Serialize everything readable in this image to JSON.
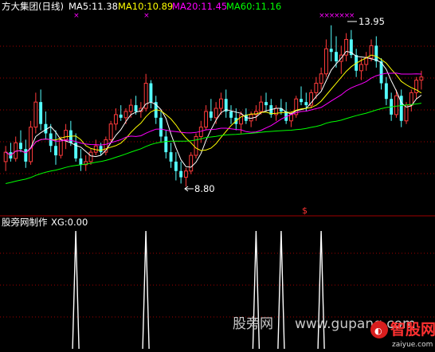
{
  "header": {
    "stock_name": "方大集团(日线)",
    "ma5_label": "MA5:11.38",
    "ma10_label": "MA10:10.89",
    "ma20_label": "MA20:11.45",
    "ma60_label": "MA60:11.16"
  },
  "colors": {
    "up": "#ff3b3b",
    "down": "#54ffff",
    "ma5": "#ffffff",
    "ma10": "#ffff00",
    "ma20": "#ff00ff",
    "ma60": "#00ff00",
    "grid": "#a00000",
    "marker": "#ff00ff",
    "signal": "#ffffff",
    "dollar": "#ff3333"
  },
  "indicator": {
    "title": "股旁网制作",
    "xg_label": "XG:0.00"
  },
  "watermark": {
    "site1": "股旁网",
    "url": "www.gupang.com",
    "brand": "智股网",
    "brand_url": "zaiyue.com"
  },
  "chart_data": [
    {
      "type": "candlestick",
      "title": "方大集团(日线)",
      "annotations": [
        {
          "text": "13.95",
          "kind": "high"
        },
        {
          "text": "8.80",
          "kind": "low"
        }
      ],
      "ohlc": [
        [
          9.6,
          10.1,
          9.3,
          9.9
        ],
        [
          9.9,
          10.2,
          9.6,
          9.7
        ],
        [
          9.7,
          10.4,
          9.6,
          10.2
        ],
        [
          10.2,
          10.6,
          9.9,
          10.0
        ],
        [
          10.0,
          10.3,
          9.4,
          9.6
        ],
        [
          9.6,
          10.9,
          9.5,
          10.7
        ],
        [
          10.7,
          11.8,
          10.5,
          11.5
        ],
        [
          11.5,
          11.9,
          10.6,
          10.8
        ],
        [
          10.8,
          11.2,
          10.3,
          10.5
        ],
        [
          10.5,
          10.8,
          9.9,
          10.1
        ],
        [
          10.1,
          10.6,
          9.5,
          9.8
        ],
        [
          9.8,
          10.4,
          9.7,
          10.3
        ],
        [
          10.3,
          10.8,
          10.0,
          10.6
        ],
        [
          10.6,
          10.9,
          10.1,
          10.2
        ],
        [
          10.2,
          10.5,
          9.6,
          9.7
        ],
        [
          9.7,
          10.0,
          9.3,
          9.5
        ],
        [
          9.5,
          9.8,
          9.3,
          9.6
        ],
        [
          9.6,
          10.0,
          9.5,
          9.9
        ],
        [
          9.9,
          10.3,
          9.8,
          10.1
        ],
        [
          10.1,
          10.2,
          9.8,
          9.9
        ],
        [
          9.9,
          10.4,
          9.8,
          10.3
        ],
        [
          10.3,
          10.9,
          10.2,
          10.8
        ],
        [
          10.8,
          11.3,
          10.6,
          11.1
        ],
        [
          11.1,
          11.4,
          10.9,
          11.0
        ],
        [
          11.0,
          11.3,
          10.8,
          11.2
        ],
        [
          11.2,
          11.6,
          11.0,
          11.4
        ],
        [
          11.4,
          11.7,
          11.1,
          11.2
        ],
        [
          11.2,
          11.5,
          11.0,
          11.3
        ],
        [
          11.3,
          12.4,
          11.2,
          12.1
        ],
        [
          12.1,
          12.2,
          11.3,
          11.5
        ],
        [
          11.5,
          11.7,
          10.8,
          11.0
        ],
        [
          11.0,
          11.2,
          10.2,
          10.4
        ],
        [
          10.4,
          10.6,
          9.7,
          9.9
        ],
        [
          9.9,
          10.2,
          9.4,
          9.6
        ],
        [
          9.6,
          9.9,
          9.0,
          9.3
        ],
        [
          9.3,
          9.6,
          8.9,
          9.1
        ],
        [
          9.1,
          9.4,
          8.8,
          9.3
        ],
        [
          9.3,
          9.9,
          9.2,
          9.8
        ],
        [
          9.8,
          10.5,
          9.7,
          10.4
        ],
        [
          10.4,
          10.9,
          10.2,
          10.7
        ],
        [
          10.7,
          11.4,
          10.6,
          11.2
        ],
        [
          11.2,
          11.6,
          10.9,
          11.0
        ],
        [
          11.0,
          11.5,
          10.8,
          11.3
        ],
        [
          11.3,
          11.8,
          11.1,
          11.6
        ],
        [
          11.6,
          11.9,
          11.0,
          11.2
        ],
        [
          11.2,
          11.4,
          10.8,
          11.0
        ],
        [
          11.0,
          11.3,
          10.6,
          10.8
        ],
        [
          10.8,
          11.2,
          10.5,
          11.1
        ],
        [
          11.1,
          11.3,
          10.8,
          10.9
        ],
        [
          10.9,
          11.2,
          10.7,
          11.1
        ],
        [
          11.1,
          11.4,
          10.9,
          11.2
        ],
        [
          11.2,
          11.7,
          11.1,
          11.5
        ],
        [
          11.5,
          11.8,
          11.2,
          11.4
        ],
        [
          11.4,
          11.6,
          11.0,
          11.1
        ],
        [
          11.1,
          11.4,
          10.9,
          11.3
        ],
        [
          11.3,
          11.6,
          11.1,
          11.2
        ],
        [
          11.2,
          11.5,
          10.8,
          10.9
        ],
        [
          10.9,
          11.2,
          10.7,
          11.1
        ],
        [
          11.1,
          11.7,
          11.0,
          11.6
        ],
        [
          11.6,
          12.0,
          11.4,
          11.5
        ],
        [
          11.5,
          11.8,
          11.2,
          11.4
        ],
        [
          11.4,
          11.9,
          11.3,
          11.8
        ],
        [
          11.8,
          12.3,
          11.6,
          12.1
        ],
        [
          12.1,
          12.6,
          11.9,
          12.4
        ],
        [
          12.4,
          13.5,
          12.3,
          13.2
        ],
        [
          13.2,
          13.95,
          12.8,
          13.1
        ],
        [
          13.1,
          13.6,
          12.6,
          12.8
        ],
        [
          12.8,
          13.3,
          12.4,
          13.0
        ],
        [
          13.0,
          13.7,
          12.8,
          13.5
        ],
        [
          13.5,
          13.8,
          12.9,
          13.0
        ],
        [
          13.0,
          13.2,
          12.3,
          12.5
        ],
        [
          12.5,
          12.9,
          12.2,
          12.7
        ],
        [
          12.7,
          13.1,
          12.5,
          12.9
        ],
        [
          12.9,
          13.5,
          12.8,
          13.3
        ],
        [
          13.3,
          13.6,
          12.6,
          12.8
        ],
        [
          12.8,
          12.9,
          11.9,
          12.1
        ],
        [
          12.1,
          12.3,
          11.4,
          11.6
        ],
        [
          11.6,
          11.8,
          10.9,
          11.1
        ],
        [
          11.1,
          11.9,
          11.0,
          11.7
        ],
        [
          11.7,
          11.9,
          10.7,
          10.9
        ],
        [
          10.9,
          11.5,
          10.8,
          11.4
        ],
        [
          11.4,
          11.9,
          11.2,
          11.8
        ],
        [
          11.8,
          12.3,
          11.6,
          12.2
        ],
        [
          12.2,
          12.5,
          11.9,
          12.3
        ]
      ],
      "ma_series": [
        {
          "name": "MA5",
          "last": 11.38
        },
        {
          "name": "MA10",
          "last": 10.89
        },
        {
          "name": "MA20",
          "last": 11.45
        },
        {
          "name": "MA60",
          "last": 11.16
        }
      ],
      "signal_days": [
        14,
        28,
        63,
        64,
        65,
        66,
        67,
        68,
        69
      ]
    },
    {
      "type": "line",
      "title": "股旁网制作",
      "series_label": "XG:0.00",
      "spike_indices": [
        14,
        28,
        50,
        55,
        63
      ]
    }
  ]
}
